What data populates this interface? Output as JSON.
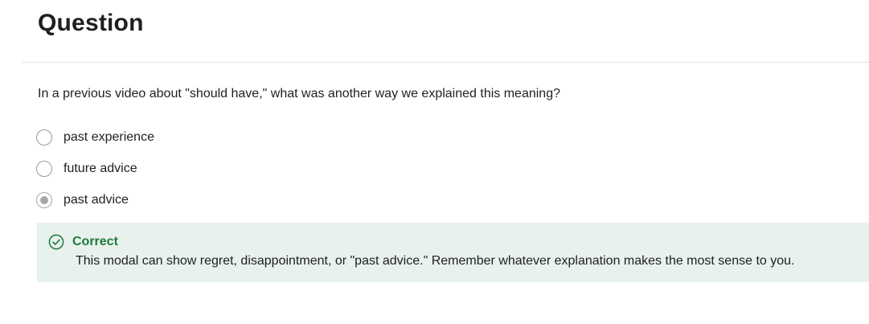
{
  "question": {
    "heading": "Question",
    "prompt": "In a previous video about \"should have,\" what was another way we explained this meaning?",
    "options": [
      {
        "label": "past experience",
        "selected": false
      },
      {
        "label": "future advice",
        "selected": false
      },
      {
        "label": "past advice",
        "selected": true
      }
    ]
  },
  "feedback": {
    "status": "Correct",
    "message": "This modal can show regret, disappointment, or \"past advice.\" Remember whatever explanation makes the most sense to you.",
    "icon": "check-circle-icon",
    "status_color": "#1d7a3b",
    "background_color": "#e8f2ec"
  }
}
